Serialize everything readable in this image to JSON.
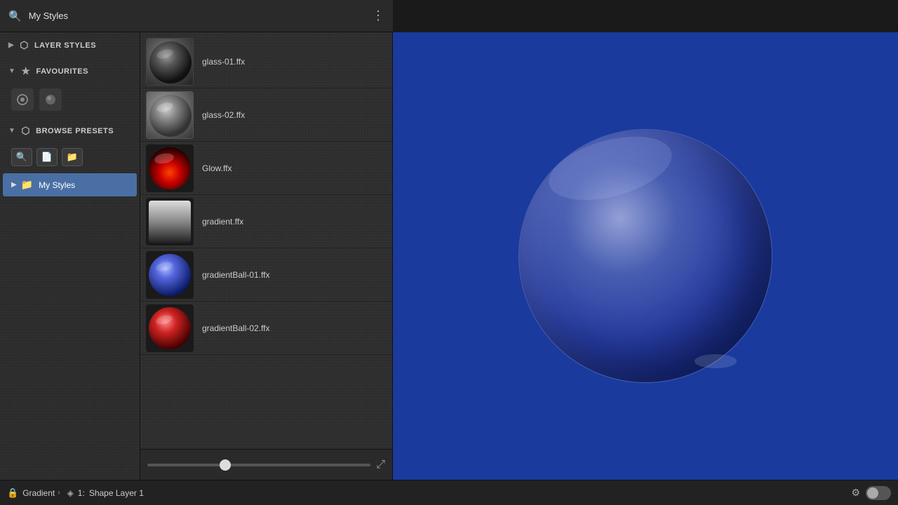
{
  "header": {
    "title": "My Styles",
    "search_icon": "🔍",
    "menu_icon": "⋮"
  },
  "sidebar": {
    "sections": [
      {
        "id": "layer-styles",
        "label": "LAYER STYLES",
        "icon": "⬡",
        "chevron": "▶",
        "expanded": false
      },
      {
        "id": "favourites",
        "label": "FAVOURITES",
        "icon": "★",
        "chevron": "▼",
        "expanded": true
      },
      {
        "id": "browse-presets",
        "label": "BROWSE PRESETS",
        "icon": "⬡",
        "chevron": "▼",
        "expanded": true
      }
    ],
    "my_styles": {
      "label": "My Styles",
      "chevron": "▶",
      "folder_icon": "📁"
    }
  },
  "presets": {
    "items": [
      {
        "id": "glass01",
        "name": "glass-01.ffx",
        "thumb_class": "thumb-glass01"
      },
      {
        "id": "glass02",
        "name": "glass-02.ffx",
        "thumb_class": "thumb-glass02"
      },
      {
        "id": "glow",
        "name": "Glow.ffx",
        "thumb_class": "thumb-glow"
      },
      {
        "id": "gradient",
        "name": "gradient.ffx",
        "thumb_class": "thumb-gradient"
      },
      {
        "id": "gradball01",
        "name": "gradientBall-01.ffx",
        "thumb_class": "thumb-gradball01"
      },
      {
        "id": "gradball02",
        "name": "gradientBall-02.ffx",
        "thumb_class": "thumb-gradball02"
      }
    ]
  },
  "status_bar": {
    "breadcrumb_item1": "Gradient",
    "chevron": "›",
    "layer_number": "1:",
    "layer_name": "Shape Layer 1",
    "lock_icon": "🔒"
  },
  "toolbar": {
    "search_label": "Search",
    "new_label": "New",
    "folder_label": "Folder"
  }
}
